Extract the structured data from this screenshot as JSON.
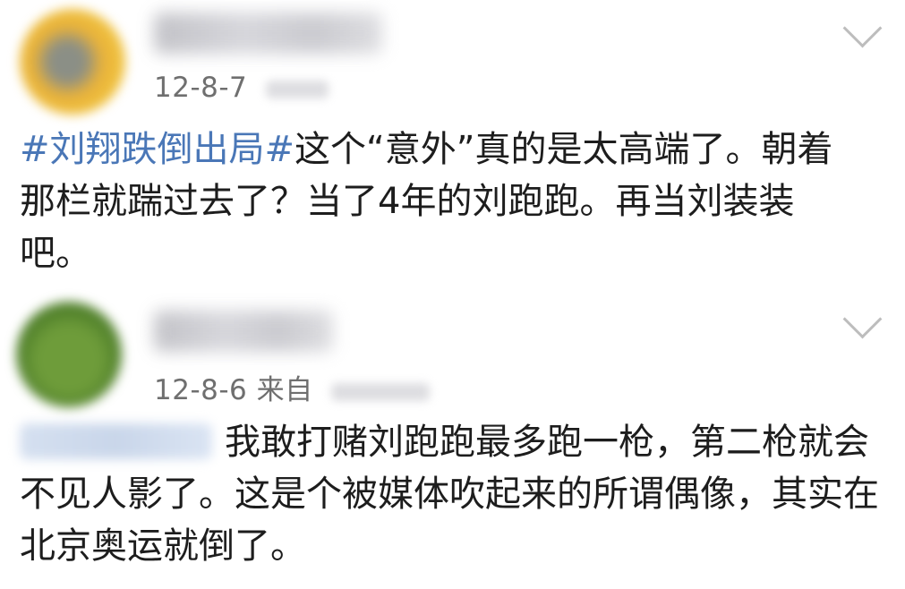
{
  "comments": [
    {
      "date": "12-8-7",
      "source_text": "",
      "topic": "#刘翔跌倒出局#",
      "text": "这个“意外”真的是太高端了。朝着那栏就踹过去了？当了4年的刘跑跑。再当刘装装吧。"
    },
    {
      "date": "12-8-6",
      "source_text": "来自",
      "topic": "",
      "text": "我敢打赌刘跑跑最多跑一枪，第二枪就会不见人影了。这是个被媒体吹起来的所谓偶像，其实在北京奥运就倒了。"
    }
  ],
  "icons": {
    "expand": "chevron-down-icon"
  },
  "colors": {
    "topic": "#4a77b7",
    "meta": "#6f6f6f",
    "text": "#1d1d1d"
  }
}
